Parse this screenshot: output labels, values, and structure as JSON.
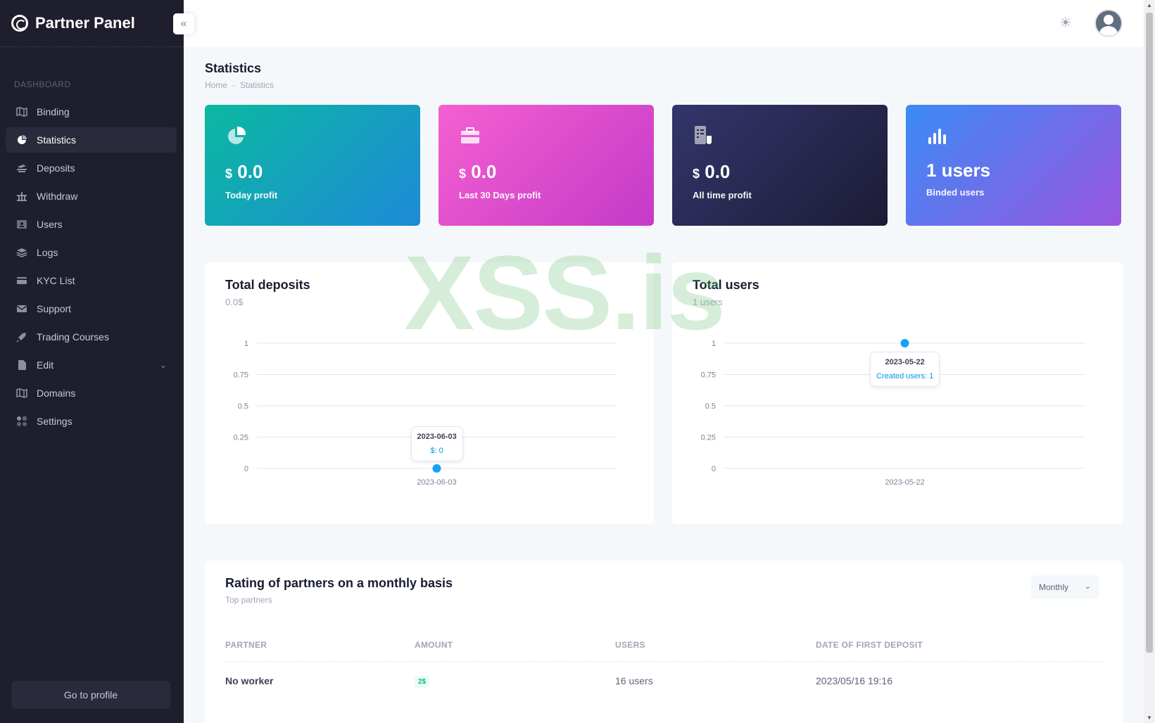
{
  "brand": {
    "title": "Partner Panel"
  },
  "sidebar": {
    "section": "DASHBOARD",
    "items": [
      {
        "label": "Binding",
        "icon": "map-icon"
      },
      {
        "label": "Statistics",
        "icon": "pie-chart-icon",
        "active": true
      },
      {
        "label": "Deposits",
        "icon": "coins-icon"
      },
      {
        "label": "Withdraw",
        "icon": "bank-icon"
      },
      {
        "label": "Users",
        "icon": "users-icon"
      },
      {
        "label": "Logs",
        "icon": "layers-icon"
      },
      {
        "label": "KYC List",
        "icon": "card-icon"
      },
      {
        "label": "Support",
        "icon": "mail-icon"
      },
      {
        "label": "Trading Courses",
        "icon": "rocket-icon"
      },
      {
        "label": "Edit",
        "icon": "document-icon"
      },
      {
        "label": "Domains",
        "icon": "map-icon"
      },
      {
        "label": "Settings",
        "icon": "grid-icon"
      }
    ],
    "profile_button": "Go to profile"
  },
  "page": {
    "title": "Statistics",
    "breadcrumb": [
      "Home",
      "-",
      "Statistics"
    ]
  },
  "stat_cards": [
    {
      "currency": "$",
      "value": "0.0",
      "label": "Today profit",
      "icon": "pie-chart-icon"
    },
    {
      "currency": "$",
      "value": "0.0",
      "label": "Last 30 Days profit",
      "icon": "briefcase-icon"
    },
    {
      "currency": "$",
      "value": "0.0",
      "label": "All time profit",
      "icon": "receipt-icon"
    },
    {
      "currency": "",
      "value": "1 users",
      "label": "Binded users",
      "icon": "bar-chart-icon"
    }
  ],
  "chart_data": [
    {
      "type": "line",
      "title": "Total deposits",
      "subtitle": "0.0$",
      "x": [
        "2023-06-03"
      ],
      "y_ticks": [
        "0",
        "0.25",
        "0.5",
        "0.75",
        "1"
      ],
      "ylim": [
        0,
        1
      ],
      "series": [
        {
          "values": [
            0
          ]
        }
      ],
      "tooltip": {
        "title": "2023-06-03",
        "value": "$: 0"
      },
      "grid": true,
      "color": "#1ba1f2"
    },
    {
      "type": "line",
      "title": "Total users",
      "subtitle": "1 users",
      "x": [
        "2023-05-22"
      ],
      "y_ticks": [
        "0",
        "0.25",
        "0.5",
        "0.75",
        "1"
      ],
      "ylim": [
        0,
        1
      ],
      "series": [
        {
          "values": [
            1
          ]
        }
      ],
      "tooltip": {
        "title": "2023-05-22",
        "value": "Created users: 1"
      },
      "grid": true,
      "color": "#1ba1f2"
    }
  ],
  "rating": {
    "title": "Rating of partners on a monthly basis",
    "subtitle": "Top partners",
    "period": "Monthly",
    "columns": [
      "PARTNER",
      "AMOUNT",
      "USERS",
      "DATE OF FIRST DEPOSIT"
    ],
    "rows": [
      {
        "partner": "No worker",
        "amount": "2$",
        "users": "16 users",
        "date": "2023/05/16 19:16"
      }
    ]
  },
  "watermark": "XSS.is"
}
